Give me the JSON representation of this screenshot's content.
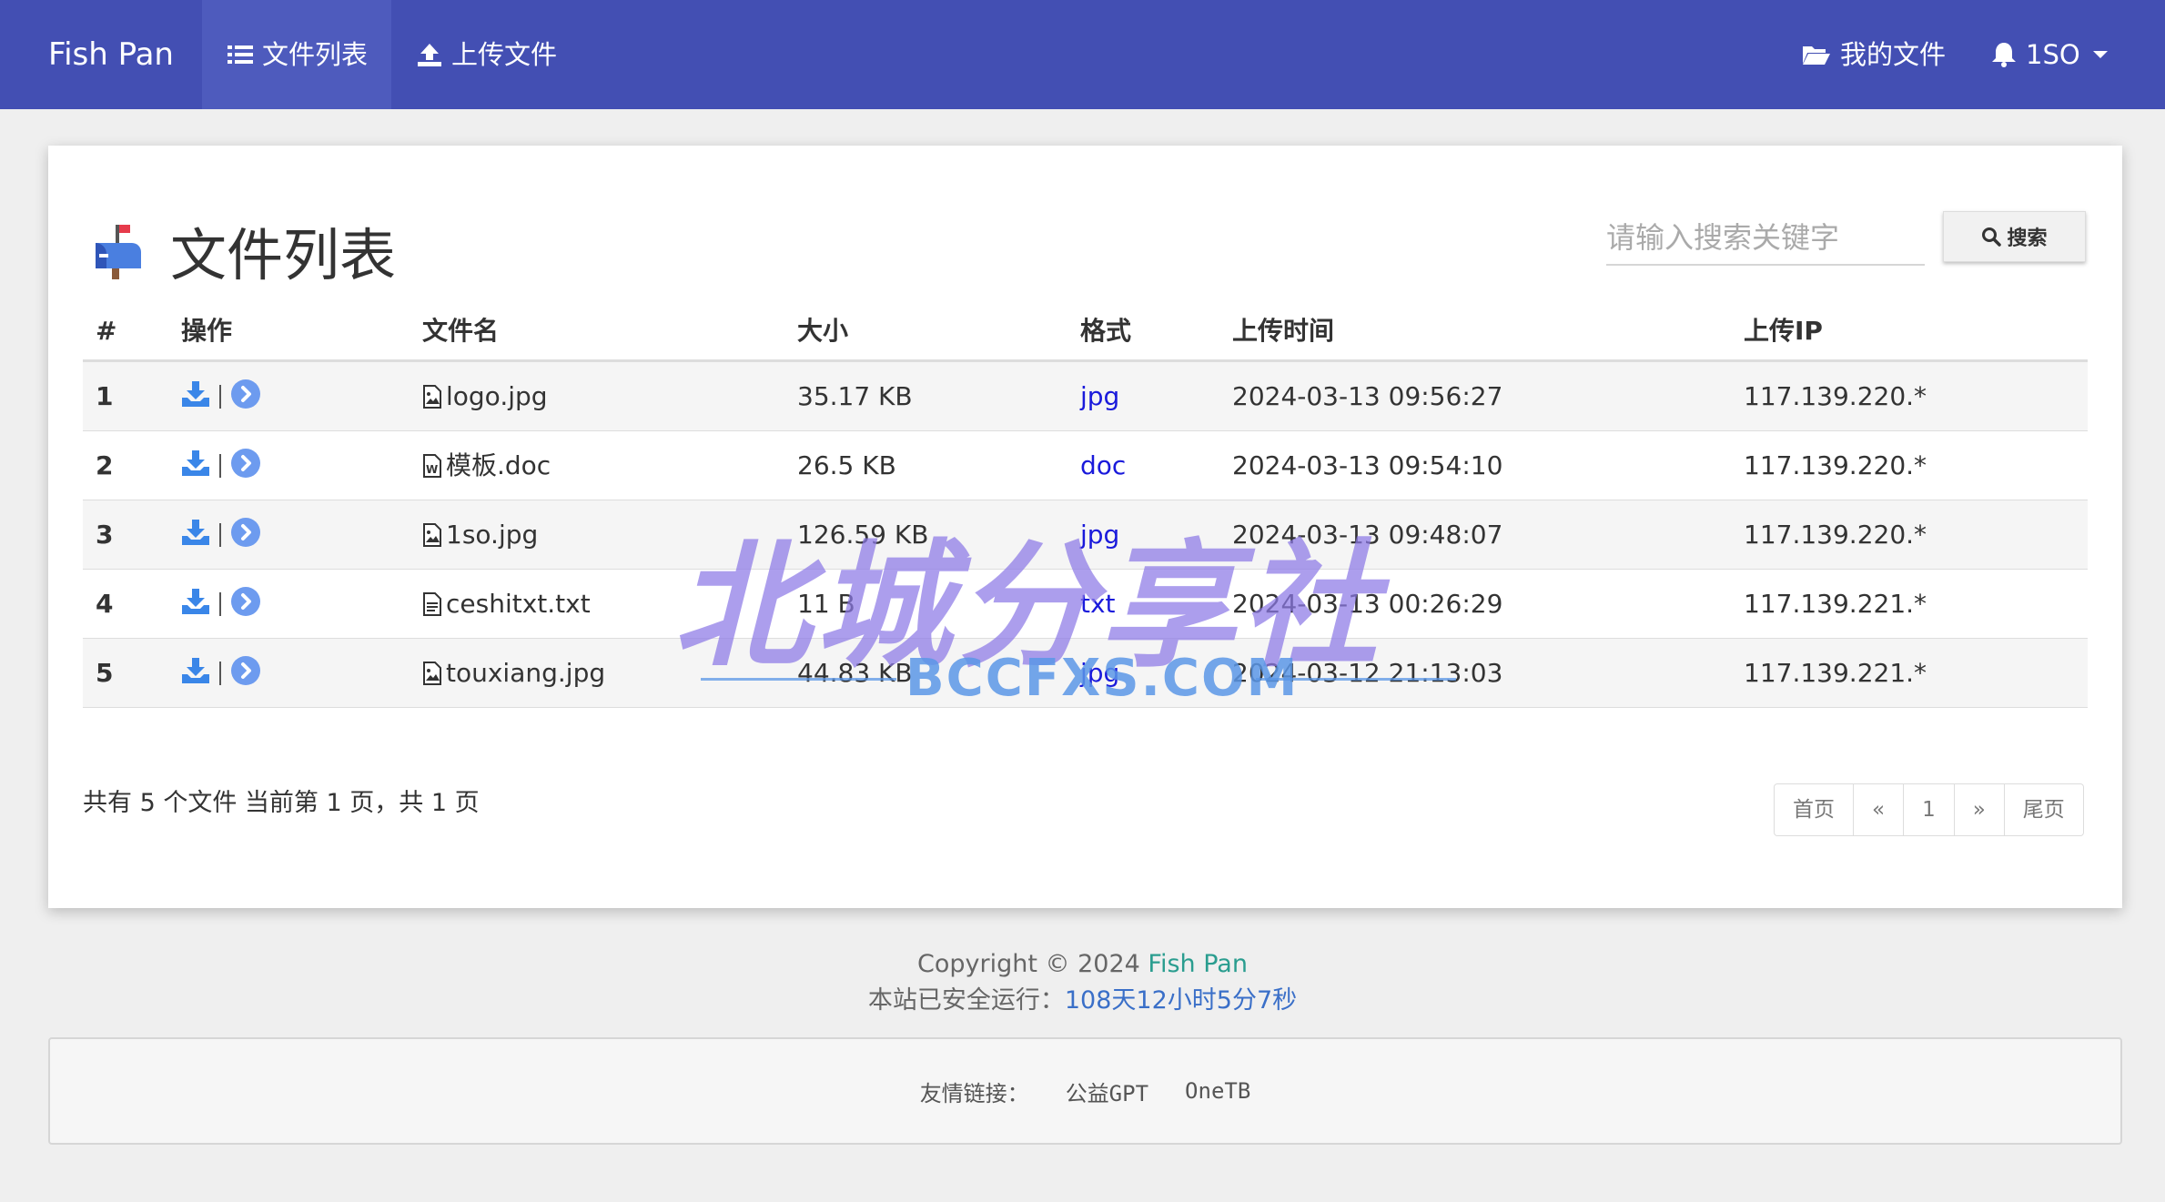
{
  "navbar": {
    "brand": "Fish Pan",
    "items": [
      {
        "label": "文件列表",
        "icon": "list-icon",
        "active": true
      },
      {
        "label": "上传文件",
        "icon": "upload-icon"
      }
    ],
    "right": [
      {
        "label": "我的文件",
        "icon": "folder-open-icon"
      },
      {
        "label": "1SO",
        "icon": "bell-icon"
      }
    ],
    "color": "#434fb3"
  },
  "panel": {
    "title": "文件列表",
    "title_icon": "mailbox-icon",
    "search_placeholder": "请输入搜索关键字",
    "search_button": "搜索"
  },
  "table": {
    "headers": [
      "#",
      "操作",
      "文件名",
      "大小",
      "格式",
      "上传时间",
      "上传IP"
    ],
    "rows": [
      {
        "num": "1",
        "name": "logo.jpg",
        "icon": "image-file-icon",
        "size": "35.17 KB",
        "format": "jpg",
        "time": "2024-03-13 09:56:27",
        "ip": "117.139.220.*"
      },
      {
        "num": "2",
        "name": "模板.doc",
        "icon": "word-file-icon",
        "size": "26.5 KB",
        "format": "doc",
        "time": "2024-03-13 09:54:10",
        "ip": "117.139.220.*"
      },
      {
        "num": "3",
        "name": "1so.jpg",
        "icon": "image-file-icon",
        "size": "126.59 KB",
        "format": "jpg",
        "time": "2024-03-13 09:48:07",
        "ip": "117.139.220.*"
      },
      {
        "num": "4",
        "name": "ceshitxt.txt",
        "icon": "text-file-icon",
        "size": "11 B",
        "format": "txt",
        "time": "2024-03-13 00:26:29",
        "ip": "117.139.221.*"
      },
      {
        "num": "5",
        "name": "touxiang.jpg",
        "icon": "image-file-icon",
        "size": "44.83 KB",
        "format": "jpg",
        "time": "2024-03-12 21:13:03",
        "ip": "117.139.221.*"
      }
    ]
  },
  "summary": "共有 5 个文件  当前第 1 页，共 1 页",
  "pager": [
    "首页",
    "«",
    "1",
    "»",
    "尾页"
  ],
  "footer": {
    "copyright_prefix": "Copyright © 2024 ",
    "copyright_brand": "Fish Pan",
    "runtime_label": "本站已安全运行：",
    "runtime_value": "108天12小时5分7秒"
  },
  "links": {
    "label": "友情链接：",
    "items": [
      "公益GPT",
      "OneTB"
    ]
  },
  "watermark": {
    "main": "北城分享社",
    "sub": "BCCFXS.COM"
  }
}
